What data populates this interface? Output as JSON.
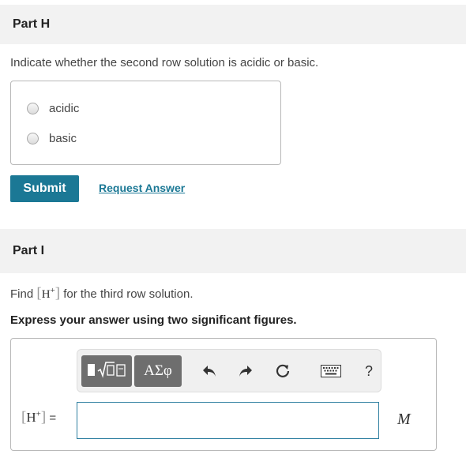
{
  "partH": {
    "title": "Part H",
    "question": "Indicate whether the second row solution is acidic or basic.",
    "options": [
      {
        "label": "acidic",
        "selected": false
      },
      {
        "label": "basic",
        "selected": false
      }
    ],
    "submit_label": "Submit",
    "request_label": "Request Answer"
  },
  "partI": {
    "title": "Part I",
    "question_prefix": "Find ",
    "question_suffix": " for the third row solution.",
    "math_symbol": "H",
    "math_sup": "+",
    "instruction": "Express your answer using two significant figures.",
    "toolbar": {
      "symbols_label": "ΑΣφ",
      "help_label": "?",
      "icons": [
        "templates-icon",
        "undo-icon",
        "redo-icon",
        "reset-icon",
        "keyboard-icon",
        "help-icon"
      ]
    },
    "answer_label_suffix": " =",
    "answer_value": "",
    "unit": "M"
  },
  "colors": {
    "accent": "#1b7895",
    "header_bg": "#f2f2f2",
    "toolbar_button_bg": "#6e6e6e"
  }
}
